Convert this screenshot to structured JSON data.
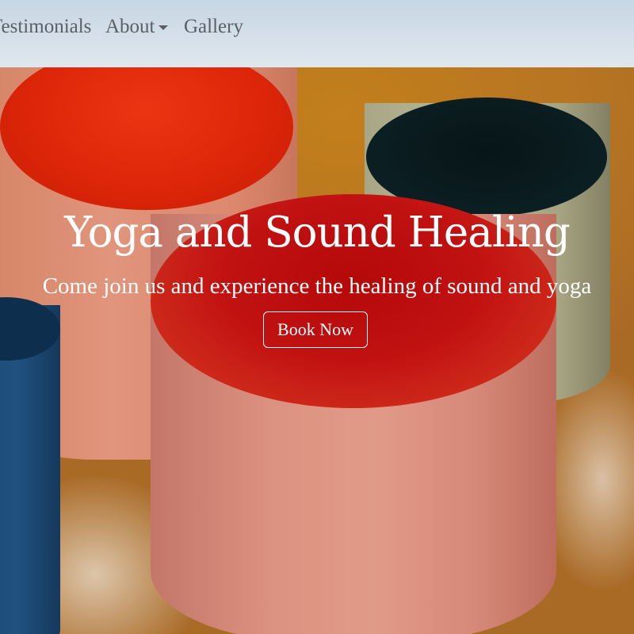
{
  "nav": {
    "items": [
      {
        "label": "Testimonials"
      },
      {
        "label": "About"
      },
      {
        "label": "Gallery"
      }
    ],
    "about_dropdown_icon": "caret-down-icon"
  },
  "hero": {
    "title": "Yoga and Sound Healing",
    "subtitle": "Come join us and experience the healing of sound and yoga",
    "cta_label": "Book Now",
    "background": "photo of crystal singing bowls",
    "colors": {
      "text": "#ffffff",
      "navbar_text": "#5a5f66"
    }
  }
}
